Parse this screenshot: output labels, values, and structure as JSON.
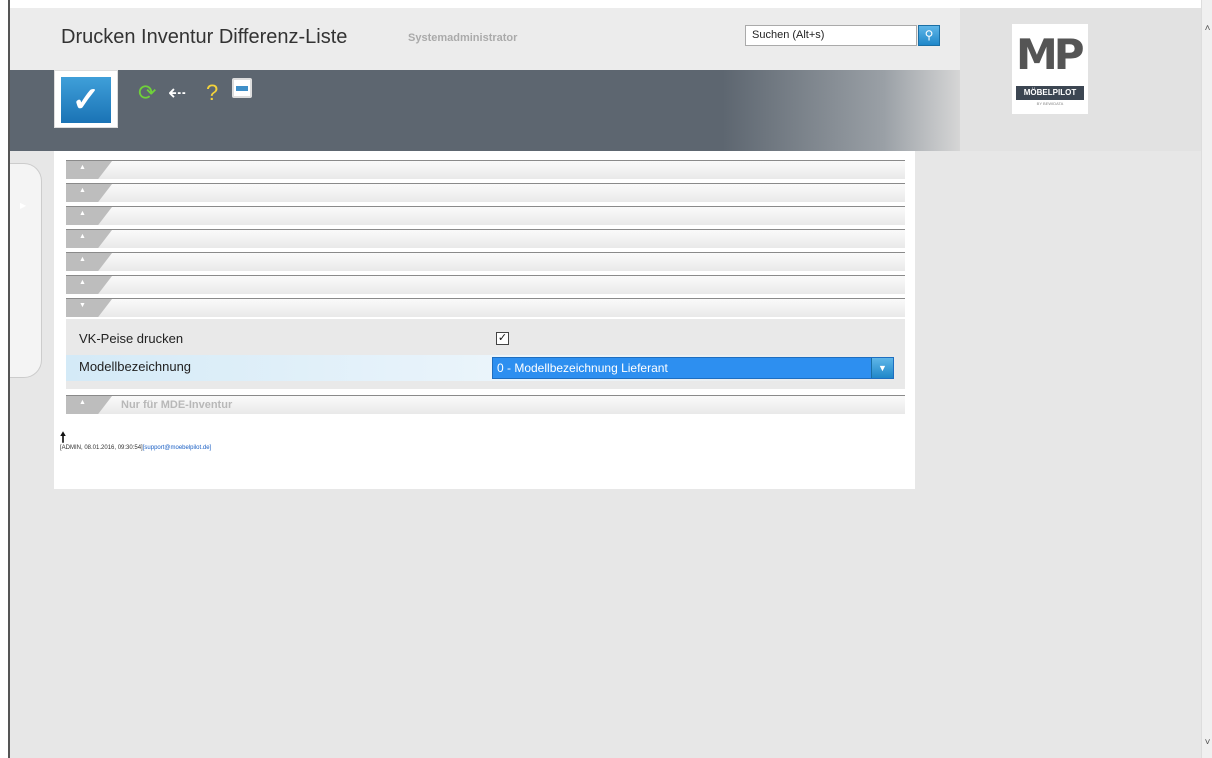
{
  "window": {
    "title": "Drucken Inventur Differenz-Liste",
    "user": "Systemadministrator"
  },
  "search": {
    "value": "Suchen (Alt+s)",
    "button_icon": "search-icon"
  },
  "toolbar": {
    "ok_icon": "checkmark-icon",
    "refresh_icon": "refresh-icon",
    "back_icon": "back-arrow-icon",
    "help_icon": "help-icon",
    "print_icon": "print-icon"
  },
  "logo": {
    "mark": "MP",
    "name": "MÖBELPILOT",
    "tagline": "BY BEWIDATA"
  },
  "sections": [
    {
      "label": "",
      "state": "collapsed"
    },
    {
      "label": "",
      "state": "collapsed"
    },
    {
      "label": "",
      "state": "collapsed"
    },
    {
      "label": "",
      "state": "collapsed"
    },
    {
      "label": "",
      "state": "collapsed"
    },
    {
      "label": "",
      "state": "collapsed"
    },
    {
      "label": "",
      "state": "expanded"
    },
    {
      "label": "Nur für MDE-Inventur",
      "state": "collapsed"
    }
  ],
  "form": {
    "vk_preise_label": "VK-Peise drucken",
    "vk_preise_checked": true,
    "modell_label": "Modellbezeichnung",
    "modell_value": "0 - Modellbezeichnung Lieferant"
  },
  "footer": {
    "meta": "[ADMIN, 08.01.2016, 09:30:54]",
    "email": "[support@moebelpilot.de]"
  },
  "colors": {
    "accent": "#1f87c9",
    "toolbar_bg": "#5d6670",
    "select_bg": "#2d8ff0"
  }
}
